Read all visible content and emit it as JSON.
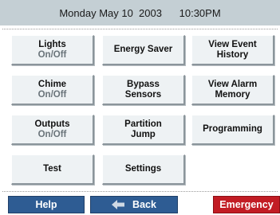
{
  "header": {
    "datetime": "Monday May 10  2003      10:30PM"
  },
  "buttons": {
    "lights": {
      "line1": "Lights",
      "line2": "On/Off"
    },
    "energy_saver": {
      "label": "Energy Saver"
    },
    "view_event_history": {
      "line1": "View Event",
      "line2": "History"
    },
    "chime": {
      "line1": "Chime",
      "line2": "On/Off"
    },
    "bypass_sensors": {
      "line1": "Bypass",
      "line2": "Sensors"
    },
    "view_alarm_memory": {
      "line1": "View Alarm",
      "line2": "Memory"
    },
    "outputs": {
      "line1": "Outputs",
      "line2": "On/Off"
    },
    "partition_jump": {
      "line1": "Partition",
      "line2": "Jump"
    },
    "programming": {
      "label": "Programming"
    },
    "test": {
      "label": "Test"
    },
    "settings": {
      "label": "Settings"
    }
  },
  "footer": {
    "help": "Help",
    "back": "Back",
    "emergency": "Emergency"
  },
  "colors": {
    "header_bg": "#c4cfd4",
    "nav_blue": "#2e5c93",
    "emergency_red": "#c21c24",
    "button_bg": "#eef2f4",
    "secondary_text": "#6a747a"
  },
  "icons": {
    "back": "left-arrow-icon"
  }
}
